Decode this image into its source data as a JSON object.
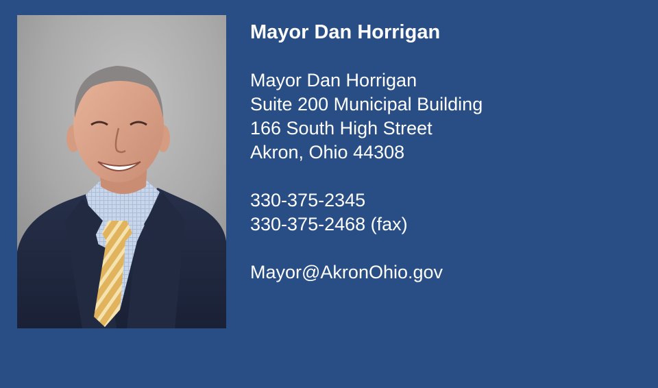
{
  "card": {
    "background_color": "#284e85",
    "text_color": "#ffffff",
    "photo": {
      "subject": "mayor-portrait"
    },
    "title": "Mayor Dan Horrigan",
    "address_lines": [
      "Mayor Dan Horrigan",
      "Suite 200 Municipal Building",
      "166 South High Street",
      "Akron, Ohio 44308"
    ],
    "phone": "330-375-2345",
    "fax": "330-375-2468 (fax)",
    "email": "Mayor@AkronOhio.gov"
  }
}
